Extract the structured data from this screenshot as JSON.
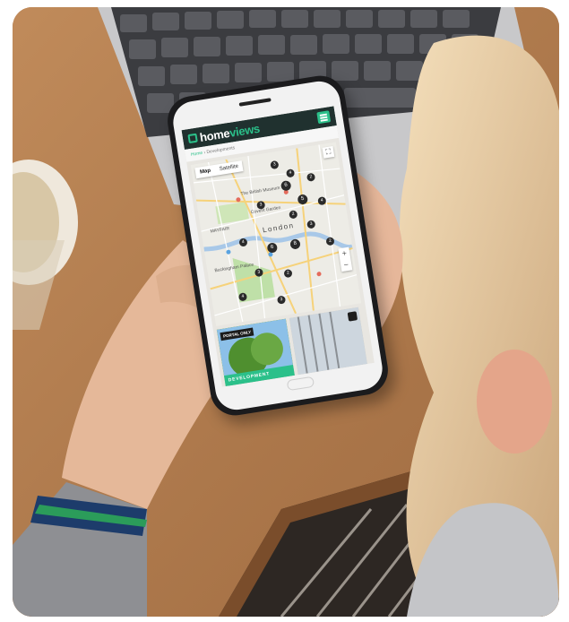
{
  "app": {
    "brand_part1": "home",
    "brand_part2": "views",
    "breadcrumb_home": "Home",
    "breadcrumb_separator": "›",
    "breadcrumb_current": "Developments",
    "accent_color": "#2bc08a",
    "header_color": "#20312f"
  },
  "map": {
    "tab_map": "Map",
    "tab_satellite": "Satellite",
    "fullscreen_icon": "fullscreen-icon",
    "zoom_in": "+",
    "zoom_out": "−",
    "labels": {
      "city": "London",
      "museum": "The British Museum",
      "garden": "Covent Garden",
      "mayfair": "MAYFAIR",
      "palace": "Buckingham Palace"
    },
    "clusters": [
      "3",
      "4",
      "6",
      "2",
      "3",
      "5",
      "4",
      "2",
      "3",
      "4",
      "6",
      "8",
      "2",
      "3",
      "2",
      "4",
      "3"
    ]
  },
  "cards": {
    "badge": "PORTAL ONLY",
    "bar_label": "DEVELOPMENT"
  }
}
